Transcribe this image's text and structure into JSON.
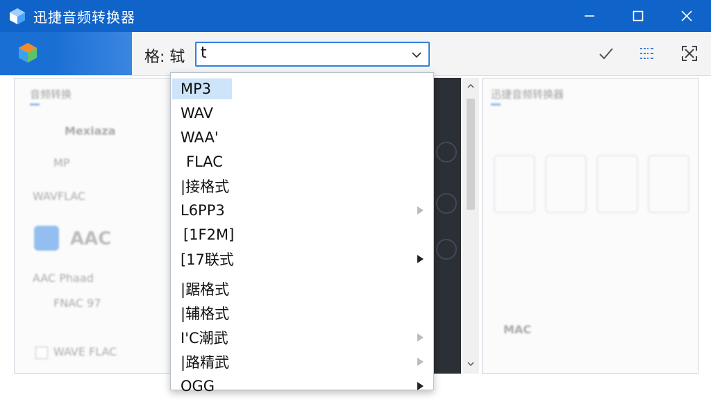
{
  "window": {
    "title": "迅捷音频转换器",
    "controls": [
      "minimize",
      "maximize",
      "close"
    ]
  },
  "toolbar": {
    "format_label": "格: 轼",
    "combo_value": "t",
    "icons": [
      "check-icon",
      "list-settings-icon",
      "fullscreen-icon"
    ]
  },
  "dropdown": {
    "items": [
      {
        "label": "MP3",
        "selected": true,
        "submenu": false
      },
      {
        "label": "WAV",
        "selected": false,
        "submenu": false
      },
      {
        "label": "WAA'",
        "selected": false,
        "submenu": false
      },
      {
        "label": "FLAC",
        "selected": false,
        "submenu": false
      },
      {
        "label": "|接格式",
        "selected": false,
        "submenu": false
      },
      {
        "label": "L6PP3",
        "selected": false,
        "submenu": true
      },
      {
        "label": "[1F2M]",
        "selected": false,
        "submenu": false
      },
      {
        "label": "[17联式",
        "selected": false,
        "submenu": true
      },
      {
        "label": "|踞格式",
        "selected": false,
        "submenu": false
      },
      {
        "label": "|辅格式",
        "selected": false,
        "submenu": false
      },
      {
        "label": "I'C潮武",
        "selected": false,
        "submenu": true
      },
      {
        "label": "|路精武",
        "selected": false,
        "submenu": true
      },
      {
        "label": "OGG",
        "selected": false,
        "submenu": true
      }
    ]
  },
  "left_panel": {
    "title": "音频转换",
    "rows": [
      "Mexiaza",
      "MP",
      "WAVFLAC",
      "AAC",
      "AAC Phaad",
      "FNAC 97",
      "WAVE FLAC"
    ]
  },
  "right_panel": {
    "title": "迅捷音频转换器",
    "footer_label": "MAC"
  },
  "colors": {
    "title_bar": "#0f63c9",
    "accent": "#2f7fe0",
    "selection": "#cde4fa"
  }
}
